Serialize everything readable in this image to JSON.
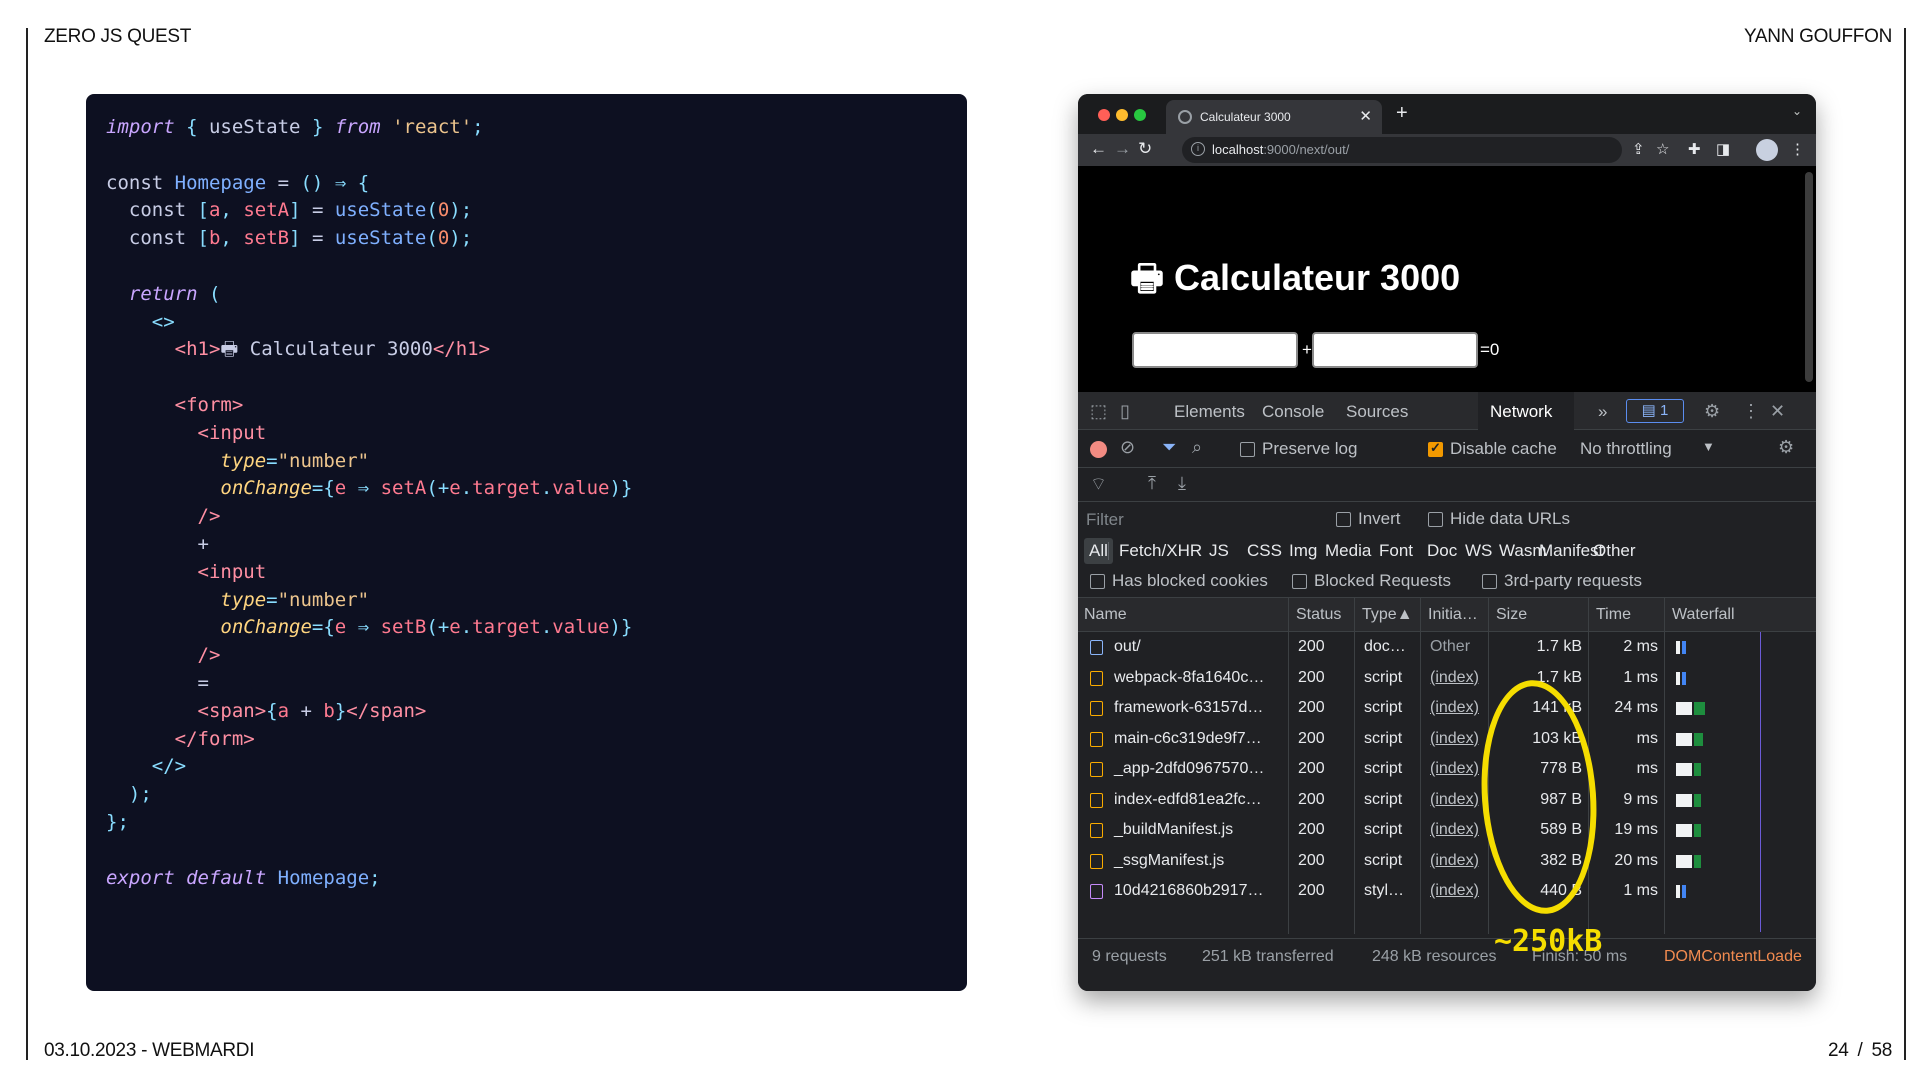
{
  "slide": {
    "top_left": "ZERO JS QUEST",
    "top_right": "YANN GOUFFON",
    "bottom_left": "03.10.2023 - WEBMARDI",
    "page_current": "24",
    "page_sep": "/",
    "page_total": "58"
  },
  "code": {
    "lines": [
      [
        [
          "kw",
          "import"
        ],
        [
          "plain",
          " "
        ],
        [
          "punc",
          "{"
        ],
        [
          "plain",
          " useState "
        ],
        [
          "punc",
          "}"
        ],
        [
          "plain",
          " "
        ],
        [
          "kw",
          "from"
        ],
        [
          "plain",
          " "
        ],
        [
          "str",
          "'react'"
        ],
        [
          "punc",
          ";"
        ]
      ],
      [],
      [
        [
          "plain",
          "const "
        ],
        [
          "fn",
          "Homepage"
        ],
        [
          "plain",
          " = "
        ],
        [
          "punc",
          "()"
        ],
        [
          "plain",
          " "
        ],
        [
          "punc",
          "⇒"
        ],
        [
          "plain",
          " "
        ],
        [
          "punc",
          "{"
        ]
      ],
      [
        [
          "plain",
          "  const "
        ],
        [
          "punc",
          "["
        ],
        [
          "var",
          "a"
        ],
        [
          "punc",
          ", "
        ],
        [
          "var",
          "setA"
        ],
        [
          "punc",
          "]"
        ],
        [
          "plain",
          " = "
        ],
        [
          "fn",
          "useState"
        ],
        [
          "punc",
          "("
        ],
        [
          "num",
          "0"
        ],
        [
          "punc",
          ");"
        ]
      ],
      [
        [
          "plain",
          "  const "
        ],
        [
          "punc",
          "["
        ],
        [
          "var",
          "b"
        ],
        [
          "punc",
          ", "
        ],
        [
          "var",
          "setB"
        ],
        [
          "punc",
          "]"
        ],
        [
          "plain",
          " = "
        ],
        [
          "fn",
          "useState"
        ],
        [
          "punc",
          "("
        ],
        [
          "num",
          "0"
        ],
        [
          "punc",
          ");"
        ]
      ],
      [],
      [
        [
          "plain",
          "  "
        ],
        [
          "kw",
          "return"
        ],
        [
          "plain",
          " "
        ],
        [
          "punc",
          "("
        ]
      ],
      [
        [
          "plain",
          "    "
        ],
        [
          "punc",
          "<>"
        ]
      ],
      [
        [
          "plain",
          "      "
        ],
        [
          "tag",
          "<h1>"
        ],
        [
          "plain",
          "🖶 Calculateur 3000"
        ],
        [
          "tag",
          "</h1>"
        ]
      ],
      [],
      [
        [
          "plain",
          "      "
        ],
        [
          "tag",
          "<form>"
        ]
      ],
      [
        [
          "plain",
          "        "
        ],
        [
          "tag",
          "<input"
        ]
      ],
      [
        [
          "plain",
          "          "
        ],
        [
          "attr",
          "type"
        ],
        [
          "punc",
          "="
        ],
        [
          "str",
          "\"number\""
        ]
      ],
      [
        [
          "plain",
          "          "
        ],
        [
          "attr",
          "onChange"
        ],
        [
          "punc",
          "={"
        ],
        [
          "var",
          "e"
        ],
        [
          "plain",
          " "
        ],
        [
          "punc",
          "⇒"
        ],
        [
          "plain",
          " "
        ],
        [
          "var",
          "setA"
        ],
        [
          "punc",
          "(+"
        ],
        [
          "var",
          "e"
        ],
        [
          "punc",
          "."
        ],
        [
          "var",
          "target"
        ],
        [
          "punc",
          "."
        ],
        [
          "var",
          "value"
        ],
        [
          "punc",
          ")}"
        ]
      ],
      [
        [
          "plain",
          "        "
        ],
        [
          "tag",
          "/>"
        ]
      ],
      [
        [
          "plain",
          "        +"
        ]
      ],
      [
        [
          "plain",
          "        "
        ],
        [
          "tag",
          "<input"
        ]
      ],
      [
        [
          "plain",
          "          "
        ],
        [
          "attr",
          "type"
        ],
        [
          "punc",
          "="
        ],
        [
          "str",
          "\"number\""
        ]
      ],
      [
        [
          "plain",
          "          "
        ],
        [
          "attr",
          "onChange"
        ],
        [
          "punc",
          "={"
        ],
        [
          "var",
          "e"
        ],
        [
          "plain",
          " "
        ],
        [
          "punc",
          "⇒"
        ],
        [
          "plain",
          " "
        ],
        [
          "var",
          "setB"
        ],
        [
          "punc",
          "(+"
        ],
        [
          "var",
          "e"
        ],
        [
          "punc",
          "."
        ],
        [
          "var",
          "target"
        ],
        [
          "punc",
          "."
        ],
        [
          "var",
          "value"
        ],
        [
          "punc",
          ")}"
        ]
      ],
      [
        [
          "plain",
          "        "
        ],
        [
          "tag",
          "/>"
        ]
      ],
      [
        [
          "plain",
          "        ="
        ]
      ],
      [
        [
          "plain",
          "        "
        ],
        [
          "tag",
          "<span>"
        ],
        [
          "punc",
          "{"
        ],
        [
          "var",
          "a"
        ],
        [
          "plain",
          " + "
        ],
        [
          "var",
          "b"
        ],
        [
          "punc",
          "}"
        ],
        [
          "tag",
          "</span>"
        ]
      ],
      [
        [
          "plain",
          "      "
        ],
        [
          "tag",
          "</form>"
        ]
      ],
      [
        [
          "plain",
          "    "
        ],
        [
          "punc",
          "</>"
        ]
      ],
      [
        [
          "plain",
          "  "
        ],
        [
          "punc",
          ");"
        ]
      ],
      [
        [
          "punc",
          "};"
        ]
      ],
      [],
      [
        [
          "kw",
          "export"
        ],
        [
          "plain",
          " "
        ],
        [
          "kw",
          "default"
        ],
        [
          "plain",
          " "
        ],
        [
          "fn",
          "Homepage"
        ],
        [
          "punc",
          ";"
        ]
      ]
    ]
  },
  "browser": {
    "tab_title": "Calculateur 3000",
    "tab_close": "✕",
    "tab_new": "+",
    "tab_menu": "⌄",
    "url_host": "localhost",
    "url_rest": ":9000/next/out/",
    "page": {
      "heading": "🖶 Calculateur 3000",
      "plus": "+",
      "equals": "=0"
    }
  },
  "devtools": {
    "tabs": [
      "Elements",
      "Console",
      "Sources",
      "Network"
    ],
    "active_tab": "Network",
    "more": "»",
    "messages_count": "1",
    "preserve_log": "Preserve log",
    "disable_cache": "Disable cache",
    "throttling": "No throttling",
    "filter_placeholder": "Filter",
    "invert": "Invert",
    "hide_data_urls": "Hide data URLs",
    "type_filters": [
      "All",
      "Fetch/XHR",
      "JS",
      "CSS",
      "Img",
      "Media",
      "Font",
      "Doc",
      "WS",
      "Wasm",
      "Manifest",
      "Other"
    ],
    "has_blocked_cookies": "Has blocked cookies",
    "blocked_requests": "Blocked Requests",
    "third_party": "3rd-party requests",
    "columns": {
      "name": "Name",
      "status": "Status",
      "type": "Type▲",
      "initiator": "Initia…",
      "size": "Size",
      "time": "Time",
      "waterfall": "Waterfall"
    },
    "requests": [
      {
        "name": "out/",
        "status": "200",
        "type": "doc…",
        "initiator": "Other",
        "size": "1.7 kB",
        "time": "2 ms",
        "icon": "doc",
        "wf": [
          0.01,
          0.02
        ]
      },
      {
        "name": "webpack-8fa1640c…",
        "status": "200",
        "type": "script",
        "initiator": "(index)",
        "size": "1.7 kB",
        "time": "1 ms",
        "icon": "script",
        "wf": [
          0.02,
          0.02
        ]
      },
      {
        "name": "framework-63157d…",
        "status": "200",
        "type": "script",
        "initiator": "(index)",
        "size": "141 kB",
        "time": "24 ms",
        "icon": "script",
        "wf": [
          0.12,
          0.09
        ]
      },
      {
        "name": "main-c6c319de9f7…",
        "status": "200",
        "type": "script",
        "initiator": "(index)",
        "size": "103 kB",
        "time": "ms",
        "icon": "script",
        "wf": [
          0.12,
          0.07
        ]
      },
      {
        "name": "_app-2dfd0967570…",
        "status": "200",
        "type": "script",
        "initiator": "(index)",
        "size": "778 B",
        "time": "ms",
        "icon": "script",
        "wf": [
          0.12,
          0.06
        ]
      },
      {
        "name": "index-edfd81ea2fc…",
        "status": "200",
        "type": "script",
        "initiator": "(index)",
        "size": "987 B",
        "time": "9 ms",
        "icon": "script",
        "wf": [
          0.12,
          0.06
        ]
      },
      {
        "name": "_buildManifest.js",
        "status": "200",
        "type": "script",
        "initiator": "(index)",
        "size": "589 B",
        "time": "19 ms",
        "icon": "script",
        "wf": [
          0.12,
          0.06
        ]
      },
      {
        "name": "_ssgManifest.js",
        "status": "200",
        "type": "script",
        "initiator": "(index)",
        "size": "382 B",
        "time": "20 ms",
        "icon": "script",
        "wf": [
          0.12,
          0.06
        ]
      },
      {
        "name": "10d4216860b2917…",
        "status": "200",
        "type": "styl…",
        "initiator": "(index)",
        "size": "440 B",
        "time": "1 ms",
        "icon": "style",
        "wf": [
          0.02,
          0.02
        ]
      }
    ],
    "summary": {
      "requests": "9 requests",
      "transferred": "251 kB transferred",
      "resources": "248 kB resources",
      "finish": "Finish: 50 ms",
      "dcl": "DOMContentLoade"
    }
  },
  "annotation": {
    "label": "~250kB",
    "color": "#f5dd00"
  }
}
